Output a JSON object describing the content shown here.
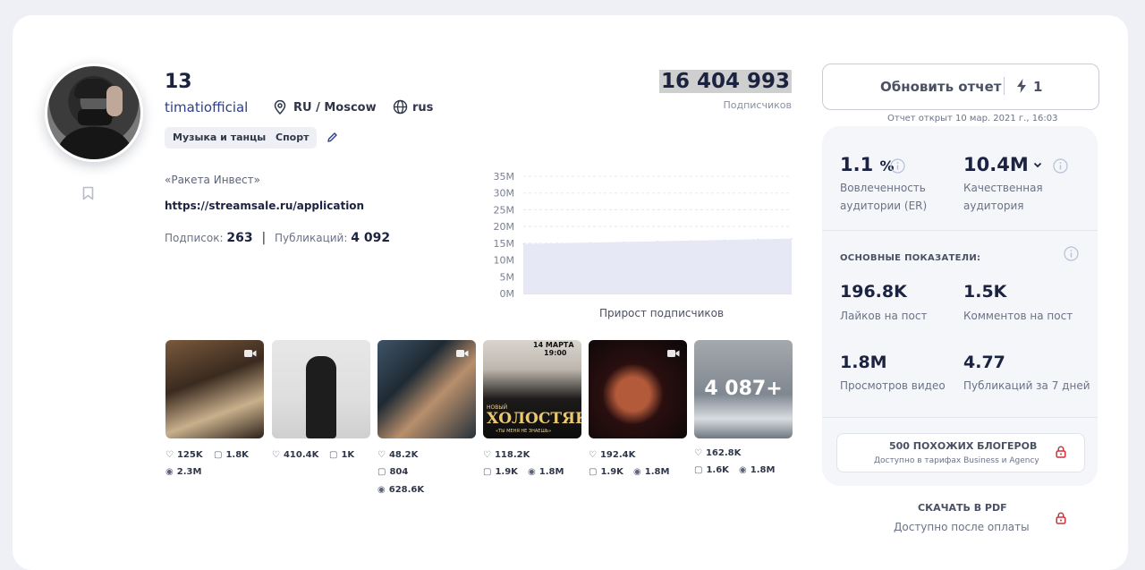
{
  "profile": {
    "name": "13",
    "username": "timatiofficial",
    "location": "RU / Moscow",
    "language": "rus",
    "tags": [
      "Музыка и танцы",
      "Спорт"
    ],
    "bio": "«Ракета Инвест»",
    "link": "https://streamsale.ru/application",
    "following_label": "Подписок:",
    "following": "263",
    "posts_label": "Публикаций:",
    "posts": "4 092",
    "followers": "16 404 993",
    "followers_label": "Подписчиков"
  },
  "chart_data": {
    "type": "area",
    "title": "Прирост подписчиков",
    "y_ticks": [
      "35M",
      "30M",
      "25M",
      "20M",
      "15M",
      "10M",
      "5M",
      "0M"
    ],
    "ylim": [
      0,
      35000000
    ],
    "series": [
      {
        "values": [
          14800000,
          15000000,
          15200000,
          15400000,
          15600000,
          15800000,
          16000000,
          16200000,
          16400000
        ]
      }
    ],
    "grid": true,
    "series_color": "#e6e8f5"
  },
  "posts": [
    {
      "likes": "125K",
      "comments": "1.8K",
      "views": "2.3M",
      "video": true
    },
    {
      "likes": "410.4K",
      "comments": "1K",
      "views": null,
      "video": false
    },
    {
      "likes": "48.2K",
      "comments": "804",
      "views": "628.6K",
      "video": true
    },
    {
      "likes": "118.2K",
      "comments": "1.9K",
      "views": "1.8M",
      "video": false,
      "overlay_top": "14 МАРТА",
      "overlay_time": "19:00",
      "overlay_small": "НОВЫЙ",
      "overlay_title": "ХОЛОСТЯК",
      "overlay_sub": "«ТЫ МЕНЯ НЕ ЗНАЕШЬ»"
    },
    {
      "likes": "192.4K",
      "comments": "1.9K",
      "views": "1.8M",
      "video": true
    },
    {
      "likes": "162.8K",
      "comments": "1.6K",
      "views": "1.8M",
      "video": false,
      "more": "4 087+"
    }
  ],
  "sidebar": {
    "refresh_label": "Обновить отчет",
    "refresh_count": "1",
    "report_date": "Отчет открыт 10 мар. 2021 г., 16:03",
    "er_value": "1.1",
    "er_unit": "%",
    "er_label_1": "Вовлеченность",
    "er_label_2": "аудитории (ER)",
    "qa_value": "10.4M",
    "qa_label_1": "Качественная",
    "qa_label_2": "аудитория",
    "section_title": "ОСНОВНЫЕ ПОКАЗАТЕЛИ:",
    "likes_value": "196.8K",
    "likes_label": "Лайков на пост",
    "comments_value": "1.5K",
    "comments_label": "Комментов на пост",
    "views_value": "1.8M",
    "views_label": "Просмотров видео",
    "pubs_value": "4.77",
    "pubs_label": "Публикаций за 7 дней",
    "similar_title": "500 ПОХОЖИХ БЛОГЕРОВ",
    "similar_sub": "Доступно в тарифах Business и Agency",
    "pdf_title": "СКАЧАТЬ В PDF",
    "pdf_sub": "Доступно после оплаты"
  },
  "colors": {
    "accent": "#2b3f8c",
    "lock": "#d0313a",
    "panel": "#f4f6fa"
  }
}
